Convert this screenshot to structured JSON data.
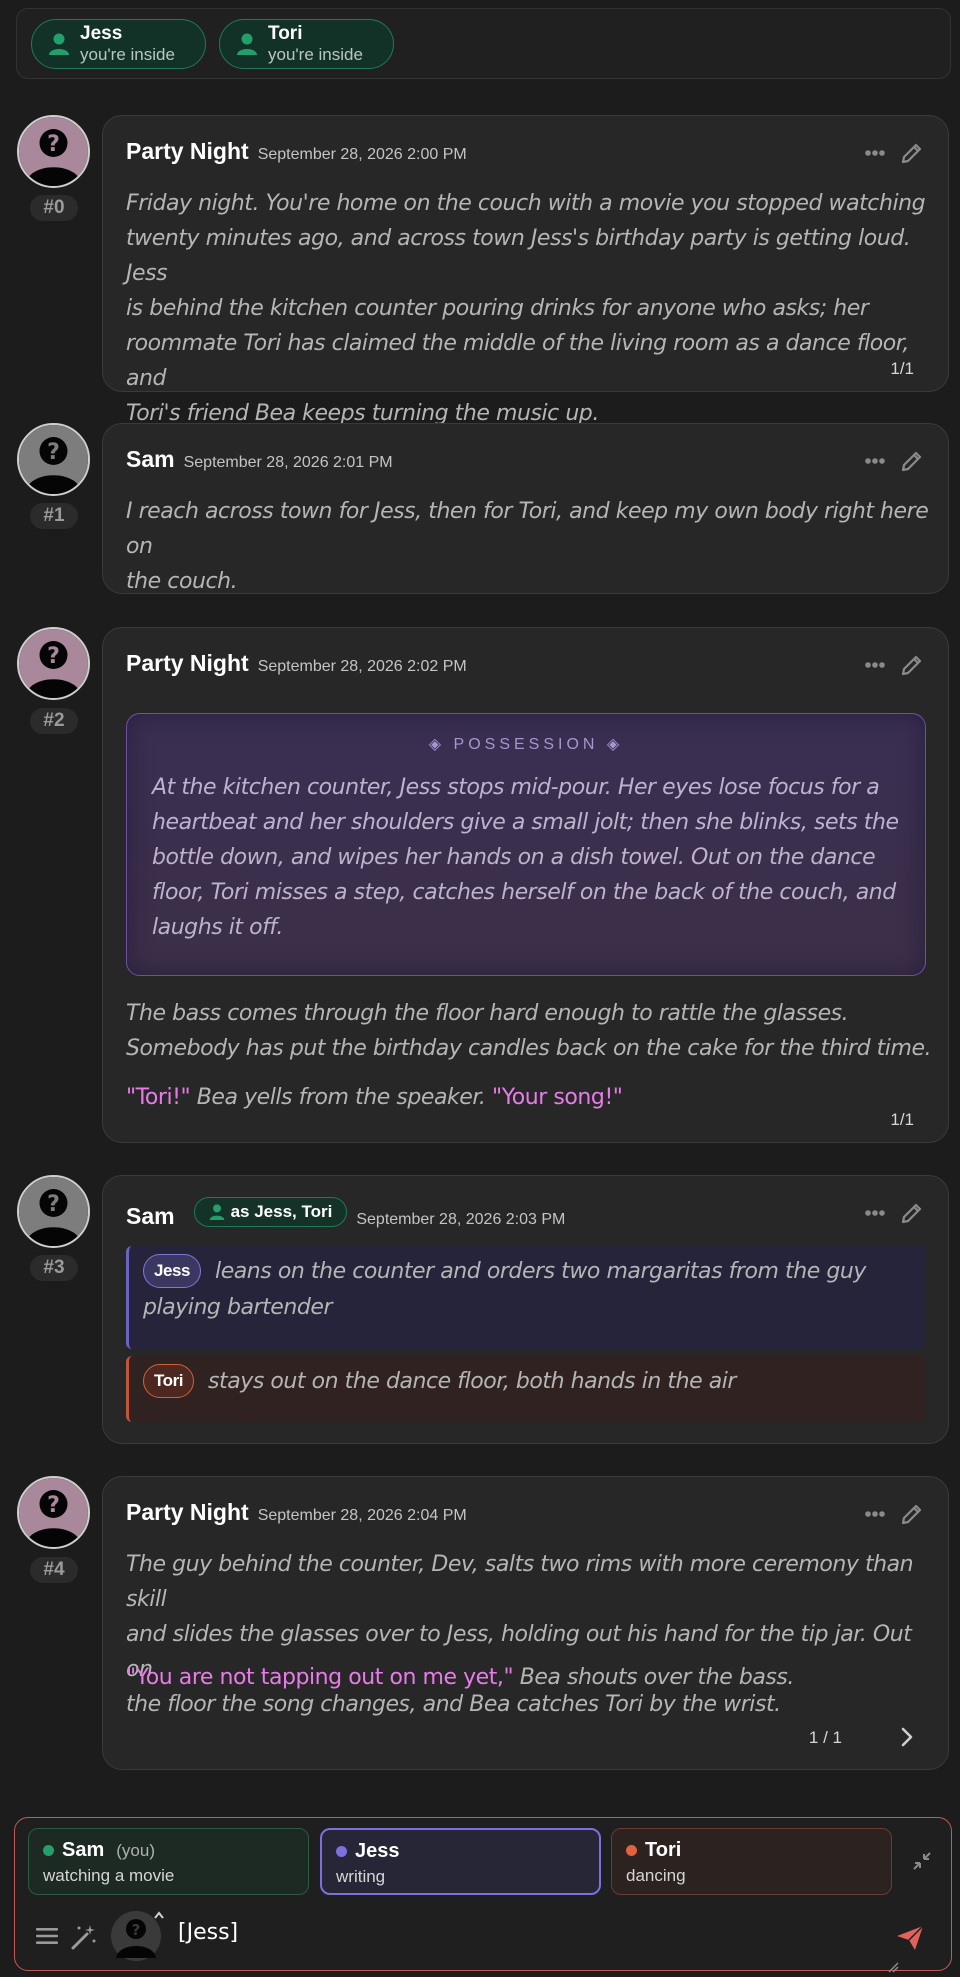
{
  "top_pills": [
    {
      "name": "Jess",
      "status": "you're inside"
    },
    {
      "name": "Tori",
      "status": "you're inside"
    }
  ],
  "messages": [
    {
      "index": "#0",
      "speaker": "Party Night",
      "timestamp": "September 28, 2026 2:00 PM",
      "lines": [
        "Friday night. You're home on the couch with a movie you stopped watching",
        "twenty minutes ago, and across town Jess's birthday party is getting loud. Jess",
        "is behind the kitchen counter pouring drinks for anyone who asks; her",
        "roommate Tori has claimed the middle of the living room as a dance floor, and",
        "Tori's friend Bea keeps turning the music up."
      ],
      "swipe": "1/1"
    },
    {
      "index": "#1",
      "speaker": "Sam",
      "timestamp": "September 28, 2026 2:01 PM",
      "lines": [
        "I reach across town for Jess, then for Tori, and keep my own body right here on",
        "the couch."
      ]
    },
    {
      "index": "#2",
      "speaker": "Party Night",
      "timestamp": "September 28, 2026 2:02 PM",
      "possession_title": "◈ POSSESSION ◈",
      "possession_lines": [
        "At the kitchen counter, Jess stops mid-pour. Her eyes lose focus for a",
        "heartbeat and her shoulders give a small jolt; then she blinks, sets the",
        "bottle down, and wipes her hands on a dish towel. Out on the dance",
        "floor, Tori misses a step, catches herself on the back of the couch, and",
        "laughs it off."
      ],
      "lines": [
        "The bass comes through the floor hard enough to rattle the glasses.",
        "Somebody has put the birthday candles back on the cake for the third time."
      ],
      "quote_1": "\"Tori!\"",
      "quote_mid": " Bea yells from the speaker. ",
      "quote_2": "\"Your song!\"",
      "swipe": "1/1"
    },
    {
      "index": "#3",
      "speaker": "Sam",
      "as_badge": "as Jess, Tori",
      "timestamp": "September 28, 2026 2:03 PM",
      "actions": [
        {
          "tag": "Jess",
          "line1": "leans on the counter and orders two margaritas from the guy",
          "line2": "playing bartender"
        },
        {
          "tag": "Tori",
          "line1": "stays out on the dance floor, both hands in the air"
        }
      ]
    },
    {
      "index": "#4",
      "speaker": "Party Night",
      "timestamp": "September 28, 2026 2:04 PM",
      "lines": [
        "The guy behind the counter, Dev, salts two rims with more ceremony than skill",
        "and slides the glasses over to Jess, holding out his hand for the tip jar. Out on",
        "the floor the song changes, and Bea catches Tori by the wrist."
      ],
      "quote_1": "\"You are not tapping out on me yet,\"",
      "quote_rest": " Bea shouts over the bass.",
      "swipe": "1 / 1"
    }
  ],
  "composer": {
    "tabs": [
      {
        "name": "Sam",
        "you": "(you)",
        "status": "watching a movie",
        "color": "#22a06b"
      },
      {
        "name": "Jess",
        "status": "writing",
        "color": "#7b70de"
      },
      {
        "name": "Tori",
        "status": "dancing",
        "color": "#e0623e"
      }
    ],
    "input_value": "[Jess]"
  },
  "icons": [
    "person-icon",
    "more-icon",
    "edit-icon",
    "chevron-right-icon",
    "collapse-icon",
    "menu-icon",
    "magic-wand-icon",
    "send-icon"
  ],
  "colors": {
    "accent_green": "#1f7a55",
    "speech_pink": "#e87be8",
    "possession_purple": "#6f4fa8",
    "send_red": "#e0625c"
  }
}
